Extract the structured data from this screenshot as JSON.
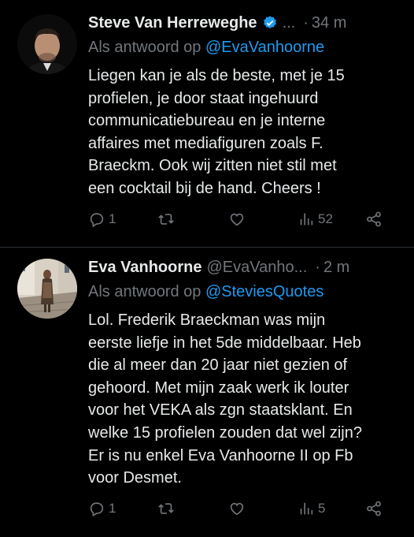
{
  "tweets": [
    {
      "name": "Steve Van Herreweghe",
      "handle": "...",
      "time": "34 m",
      "reply_prefix": "Als antwoord op",
      "reply_to": "@EvaVanhoorne",
      "lines": [
        "Liegen kan je als de beste, met je 15",
        "profielen, je door staat ingehuurd",
        "communicatiebureau en je interne",
        "affaires met mediafiguren zoals F.",
        "Braeckm. Ook wij zitten niet stil met",
        "een cocktail bij de hand. Cheers !"
      ],
      "replies": "1",
      "views": "52"
    },
    {
      "name": "Eva Vanhoorne",
      "handle": "@EvaVanho...",
      "time": "2 m",
      "reply_prefix": "Als antwoord op",
      "reply_to": "@SteviesQuotes",
      "lines": [
        "Lol. Frederik  Braeckman was mijn",
        "eerste liefje in het 5de middelbaar. Heb",
        "die al meer dan 20 jaar niet gezien of",
        "gehoord. Met mijn zaak werk ik louter",
        "voor het VEKA als zgn staatsklant. En",
        "welke 15 profielen zouden dat wel zijn?",
        "Er is nu enkel Eva Vanhoorne II op Fb",
        "voor Desmet."
      ],
      "replies": "1",
      "views": "5"
    }
  ],
  "colors": {
    "background": "#000000",
    "text": "#e7e9ea",
    "muted": "#71767b",
    "link": "#1d9bf0",
    "verified": "#1d9bf0"
  },
  "icons": [
    "verified-badge-icon",
    "reply-icon",
    "retweet-icon",
    "like-icon",
    "views-icon",
    "share-icon"
  ]
}
